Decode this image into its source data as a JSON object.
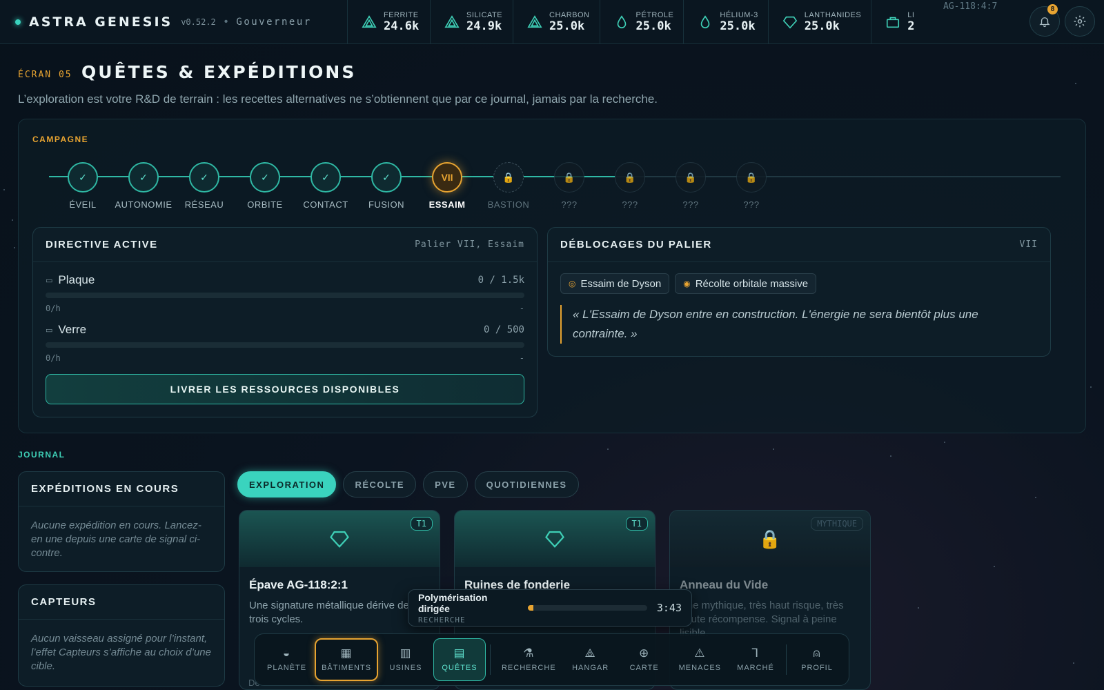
{
  "app": {
    "name": "ASTRA GENESIS",
    "version": "v0.52.2",
    "separator": "•",
    "role": "Gouverneur",
    "code": "AG-118:4:7",
    "notifications": "8"
  },
  "resources": [
    {
      "name": "FERRITE",
      "value": "24.6k",
      "icon": "triangle-icon"
    },
    {
      "name": "SILICATE",
      "value": "24.9k",
      "icon": "triangle-icon"
    },
    {
      "name": "CHARBON",
      "value": "25.0k",
      "icon": "triangle-icon"
    },
    {
      "name": "PÉTROLE",
      "value": "25.0k",
      "icon": "drop-icon"
    },
    {
      "name": "HÉLIUM-3",
      "value": "25.0k",
      "icon": "drop-icon"
    },
    {
      "name": "LANTHANIDES",
      "value": "25.0k",
      "icon": "diamond-icon"
    },
    {
      "name": "LI",
      "value": "2",
      "icon": "crate-icon"
    }
  ],
  "header": {
    "eyebrow": "ÉCRAN 05",
    "title": "QUÊTES & EXPÉDITIONS",
    "subtitle": "L’exploration est votre R&D de terrain : les recettes alternatives ne s’obtiennent que par ce journal, jamais par la recherche."
  },
  "campaign": {
    "label": "CAMPAGNE",
    "steps": [
      {
        "label": "ÉVEIL",
        "state": "done",
        "mark": "✓"
      },
      {
        "label": "AUTONOMIE",
        "state": "done",
        "mark": "✓"
      },
      {
        "label": "RÉSEAU",
        "state": "done",
        "mark": "✓"
      },
      {
        "label": "ORBITE",
        "state": "done",
        "mark": "✓"
      },
      {
        "label": "CONTACT",
        "state": "done",
        "mark": "✓"
      },
      {
        "label": "FUSION",
        "state": "done",
        "mark": "✓"
      },
      {
        "label": "ESSAIM",
        "state": "current",
        "mark": "VII"
      },
      {
        "label": "BASTION",
        "state": "locked",
        "mark": "🔒"
      },
      {
        "label": "???",
        "state": "hidden",
        "mark": "🔒"
      },
      {
        "label": "???",
        "state": "hidden",
        "mark": "🔒"
      },
      {
        "label": "???",
        "state": "hidden",
        "mark": "🔒"
      },
      {
        "label": "???",
        "state": "hidden",
        "mark": "🔒"
      }
    ]
  },
  "directive": {
    "title": "DIRECTIVE ACTIVE",
    "meta": "Palier VII, Essaim",
    "requirements": [
      {
        "name": "Plaque",
        "qty": "0 / 1.5k",
        "progress": 0,
        "rate": "0/h",
        "eta": "-"
      },
      {
        "name": "Verre",
        "qty": "0 / 500",
        "progress": 0,
        "rate": "0/h",
        "eta": "-"
      }
    ],
    "button": "LIVRER LES RESSOURCES DISPONIBLES"
  },
  "unlocks": {
    "title": "DÉBLOCAGES DU PALIER",
    "tier": "VII",
    "chips": [
      "Essaim de Dyson",
      "Récolte orbitale massive"
    ],
    "quote": "« L'Essaim de Dyson entre en construction. L'énergie ne sera bientôt plus une contrainte. »"
  },
  "journal": {
    "label": "JOURNAL",
    "expeditions": {
      "title": "EXPÉDITIONS EN COURS",
      "empty": "Aucune expédition en cours. Lancez-en une depuis une carte de signal ci-contre."
    },
    "sensors": {
      "title": "CAPTEURS",
      "empty": "Aucun vaisseau assigné pour l’instant, l’effet Capteurs s’affiche au choix d’une cible."
    },
    "tabs": [
      "EXPLORATION",
      "RÉCOLTE",
      "PVE",
      "QUOTIDIENNES"
    ],
    "active_tab": 0,
    "cards": [
      {
        "tier": "T1",
        "title": "Épave AG-118:2:1",
        "desc": "Une signature métallique dérive depuis trois cycles.",
        "locked": false
      },
      {
        "tier": "T1",
        "title": "Ruines de fonderie",
        "desc": "",
        "locked": false
      },
      {
        "tier": "MYTHIQUE",
        "title": "Anneau du Vide",
        "desc": "Une mythique, très haut risque, très haute récompense. Signal à peine lisible.",
        "locked": true
      }
    ],
    "footer_fragment": "Dé"
  },
  "toast": {
    "title": "Polymérisation dirigée",
    "kind": "RECHERCHE",
    "time": "3:43",
    "progress": 0.05
  },
  "nav": [
    {
      "label": "PLANÈTE",
      "icon": "planet-icon",
      "glyph": "◒"
    },
    {
      "label": "BÂTIMENTS",
      "icon": "buildings-icon",
      "glyph": "▦"
    },
    {
      "label": "USINES",
      "icon": "factory-icon",
      "glyph": "▥"
    },
    {
      "label": "QUÊTES",
      "icon": "scroll-icon",
      "glyph": "▤"
    },
    {
      "label": "RECHERCHE",
      "icon": "flask-icon",
      "glyph": "⚗"
    },
    {
      "label": "HANGAR",
      "icon": "ship-icon",
      "glyph": "⟁"
    },
    {
      "label": "CARTE",
      "icon": "globe-icon",
      "glyph": "⊕"
    },
    {
      "label": "MENACES",
      "icon": "warning-icon",
      "glyph": "⚠"
    },
    {
      "label": "MARCHÉ",
      "icon": "market-icon",
      "glyph": "⅂"
    },
    {
      "label": "PROFIL",
      "icon": "user-icon",
      "glyph": "⍝"
    }
  ],
  "colors": {
    "accent": "#3ecfb6",
    "warning": "#e8a431",
    "bg": "#08121b"
  }
}
